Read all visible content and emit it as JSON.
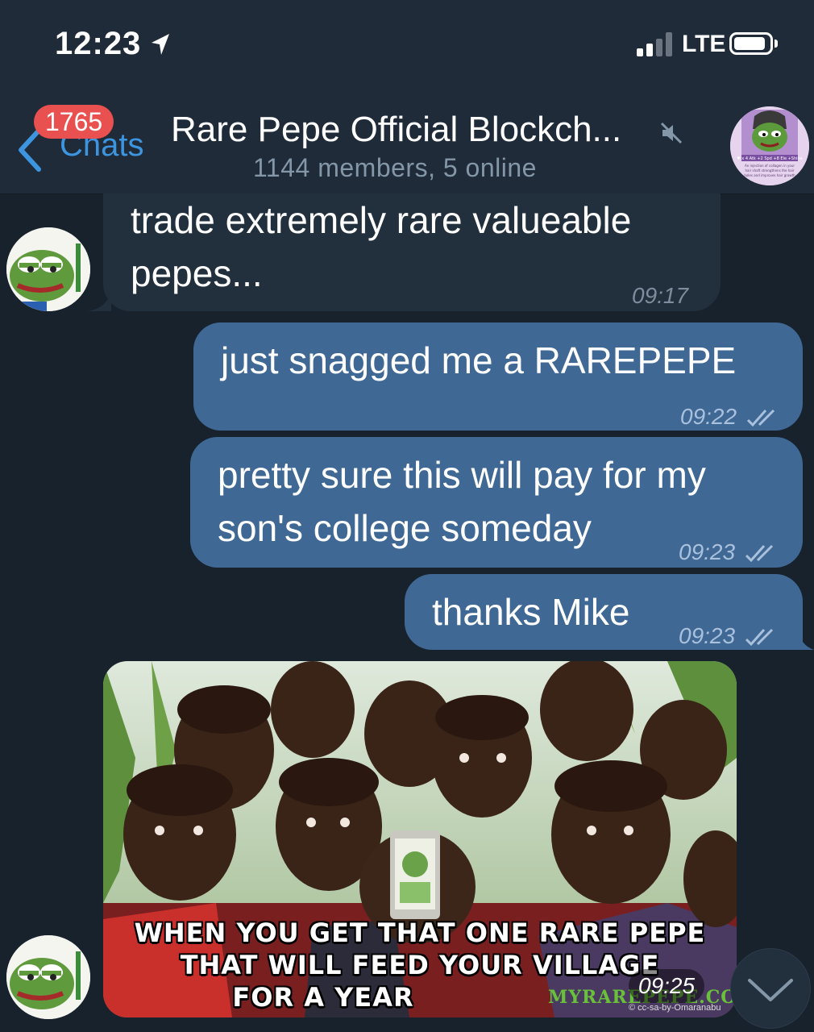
{
  "status_bar": {
    "time": "12:23",
    "network": "LTE",
    "icons": [
      "location-arrow-icon",
      "cellular-signal-icon",
      "battery-icon"
    ]
  },
  "header": {
    "back_label": "Chats",
    "unread_badge": "1765",
    "title": "Rare Pepe Official Blockch...",
    "subtitle": "1144 members, 5 online",
    "muted": true,
    "avatar_caption_lines": [
      "♥ x 4  Atk +2  Spd +8  Ele +Shine",
      "An injection of collagen in your",
      "hair shaft strengthens the hair",
      "holes and improves hair growth"
    ]
  },
  "messages": [
    {
      "direction": "incoming",
      "text_lines": [
        "trade extremely rare valueable",
        "pepes..."
      ],
      "time": "09:17"
    },
    {
      "direction": "outgoing",
      "text_lines": [
        "just snagged me a RAREPEPE"
      ],
      "time": "09:22",
      "status": "read"
    },
    {
      "direction": "outgoing",
      "text_lines": [
        "pretty sure this will pay for my",
        "son's college someday"
      ],
      "time": "09:23",
      "status": "read"
    },
    {
      "direction": "outgoing",
      "text_lines": [
        "thanks Mike"
      ],
      "time": "09:23",
      "status": "read"
    },
    {
      "direction": "incoming",
      "type": "photo",
      "caption_lines": [
        "WHEN YOU GET THAT ONE RARE PEPE",
        "THAT WILL FEED YOUR VILLAGE",
        "FOR A YEAR"
      ],
      "watermark": "MYRAREPEPE.COM",
      "license": "© cc-sa-by-Omaranabu",
      "time": "09:25"
    }
  ],
  "colors": {
    "background": "#18222d",
    "header": "#1f2b38",
    "incoming_bubble": "#222f3d",
    "outgoing_bubble": "#3f6895",
    "accent": "#3d95e0",
    "badge": "#e8514f"
  }
}
